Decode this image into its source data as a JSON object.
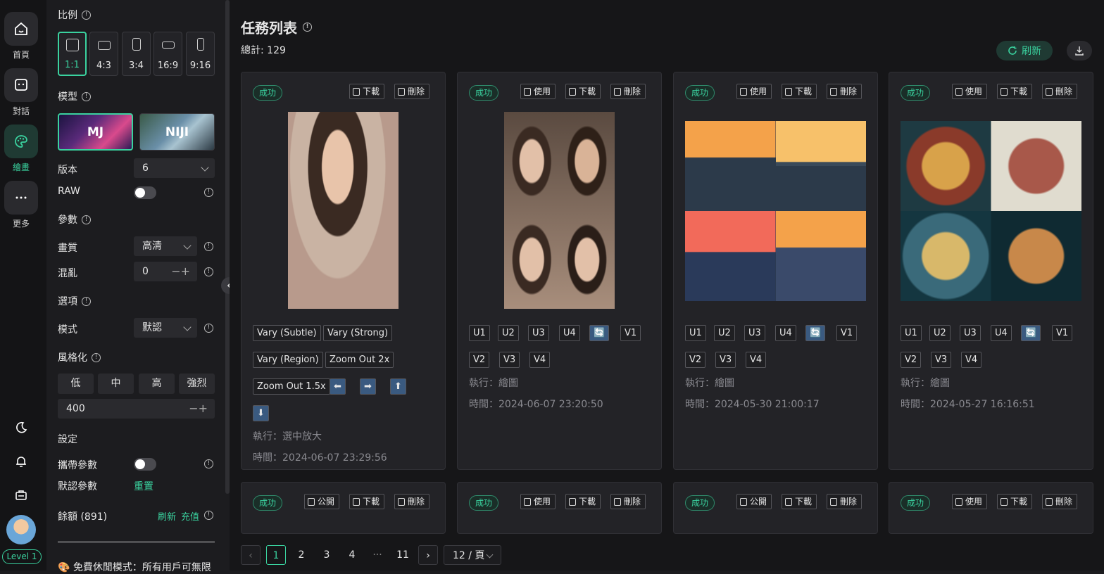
{
  "rail": {
    "home": "首頁",
    "chat": "對話",
    "draw": "繪畫",
    "more": "更多",
    "level": "Level 1"
  },
  "sidebar": {
    "ratio_title": "比例",
    "ratios": [
      "1:1",
      "4:3",
      "3:4",
      "16:9",
      "9:16"
    ],
    "model_title": "模型",
    "models": [
      "MJ",
      "NIJI"
    ],
    "version_label": "版本",
    "version_value": "6",
    "raw_label": "RAW",
    "params_title": "參數",
    "quality_label": "畫質",
    "quality_value": "高清",
    "chaos_label": "混亂",
    "chaos_value": "0",
    "options_title": "選項",
    "mode_label": "模式",
    "mode_value": "默認",
    "stylize_title": "風格化",
    "stylize_options": [
      "低",
      "中",
      "高",
      "強烈"
    ],
    "stylize_value": "400",
    "settings_title": "設定",
    "carry_params_label": "攜帶參數",
    "default_params_label": "默認參數",
    "reset_label": "重置",
    "balance_label": "餘額 (891)",
    "refresh_label": "刷新",
    "recharge_label": "充值",
    "free_mode_text": "🎨 免費休閒模式：所有用戶可無限"
  },
  "main": {
    "title": "任務列表",
    "total": "總計: 129",
    "refresh_btn": "刷新",
    "status": "成功",
    "btn_use": "使用",
    "btn_download": "下載",
    "btn_delete": "刪除",
    "btn_public": "公開",
    "card1": {
      "actions": [
        "Vary (Subtle)",
        "Vary (Strong)",
        "Vary (Region)",
        "Zoom Out 2x",
        "Zoom Out 1.5x"
      ],
      "exec": "執行：選中放大",
      "time": "時間：2024-06-07 23:29:56"
    },
    "grid_actions": [
      "U1",
      "U2",
      "U3",
      "U4",
      "V1",
      "V2",
      "V3",
      "V4"
    ],
    "card2": {
      "exec": "執行：繪圖",
      "time": "時間：2024-06-07 23:20:50"
    },
    "card3": {
      "exec": "執行：繪圖",
      "time": "時間：2024-05-30 21:00:17"
    },
    "card4": {
      "exec": "執行：繪圖",
      "time": "時間：2024-05-27 16:16:51"
    },
    "pagination": {
      "pages": [
        "1",
        "2",
        "3",
        "4",
        "···",
        "11"
      ],
      "page_size": "12 / 頁"
    }
  }
}
